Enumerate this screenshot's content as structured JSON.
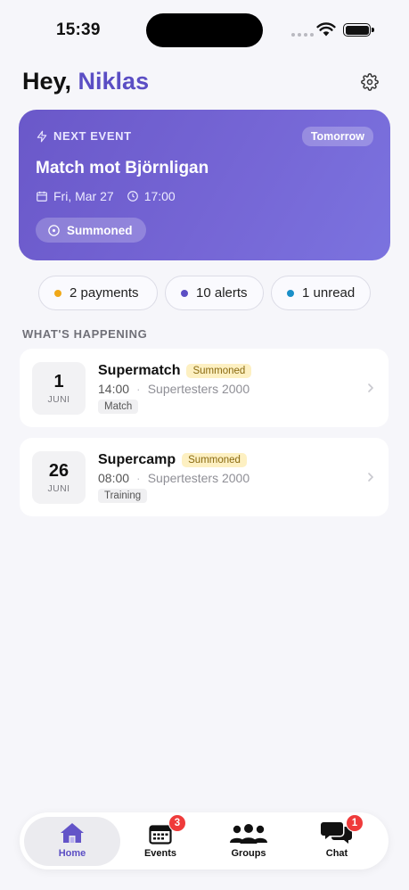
{
  "status_bar": {
    "time": "15:39"
  },
  "header": {
    "greeting": "Hey, ",
    "user_name": "Niklas"
  },
  "next_event": {
    "label": "NEXT EVENT",
    "when_badge": "Tomorrow",
    "title": "Match mot Björnligan",
    "date": "Fri, Mar 27",
    "time": "17:00",
    "status": "Summoned"
  },
  "summary_pills": [
    {
      "label": "2 payments",
      "color": "#f0a818"
    },
    {
      "label": "10 alerts",
      "color": "#5b4ec4"
    },
    {
      "label": "1 unread",
      "color": "#1a8fc8"
    }
  ],
  "section": {
    "title": "WHAT'S HAPPENING"
  },
  "events": [
    {
      "day": "1",
      "month": "JUNI",
      "name": "Supermatch",
      "status": "Summoned",
      "time": "14:00",
      "separator": "·",
      "group": "Supertesters 2000",
      "type": "Match"
    },
    {
      "day": "26",
      "month": "JUNI",
      "name": "Supercamp",
      "status": "Summoned",
      "time": "08:00",
      "separator": "·",
      "group": "Supertesters 2000",
      "type": "Training"
    }
  ],
  "tabbar": {
    "tabs": [
      {
        "label": "Home",
        "icon": "home-icon",
        "active": true
      },
      {
        "label": "Events",
        "icon": "calendar-icon",
        "badge": "3"
      },
      {
        "label": "Groups",
        "icon": "groups-icon"
      },
      {
        "label": "Chat",
        "icon": "chat-icon",
        "badge": "1"
      }
    ]
  },
  "colors": {
    "accent": "#5b4ec4",
    "card_gradient_start": "#6a58c9",
    "card_gradient_end": "#7b73df",
    "badge_red": "#ef3b3b",
    "summoned_bg": "#fdf0c2"
  }
}
